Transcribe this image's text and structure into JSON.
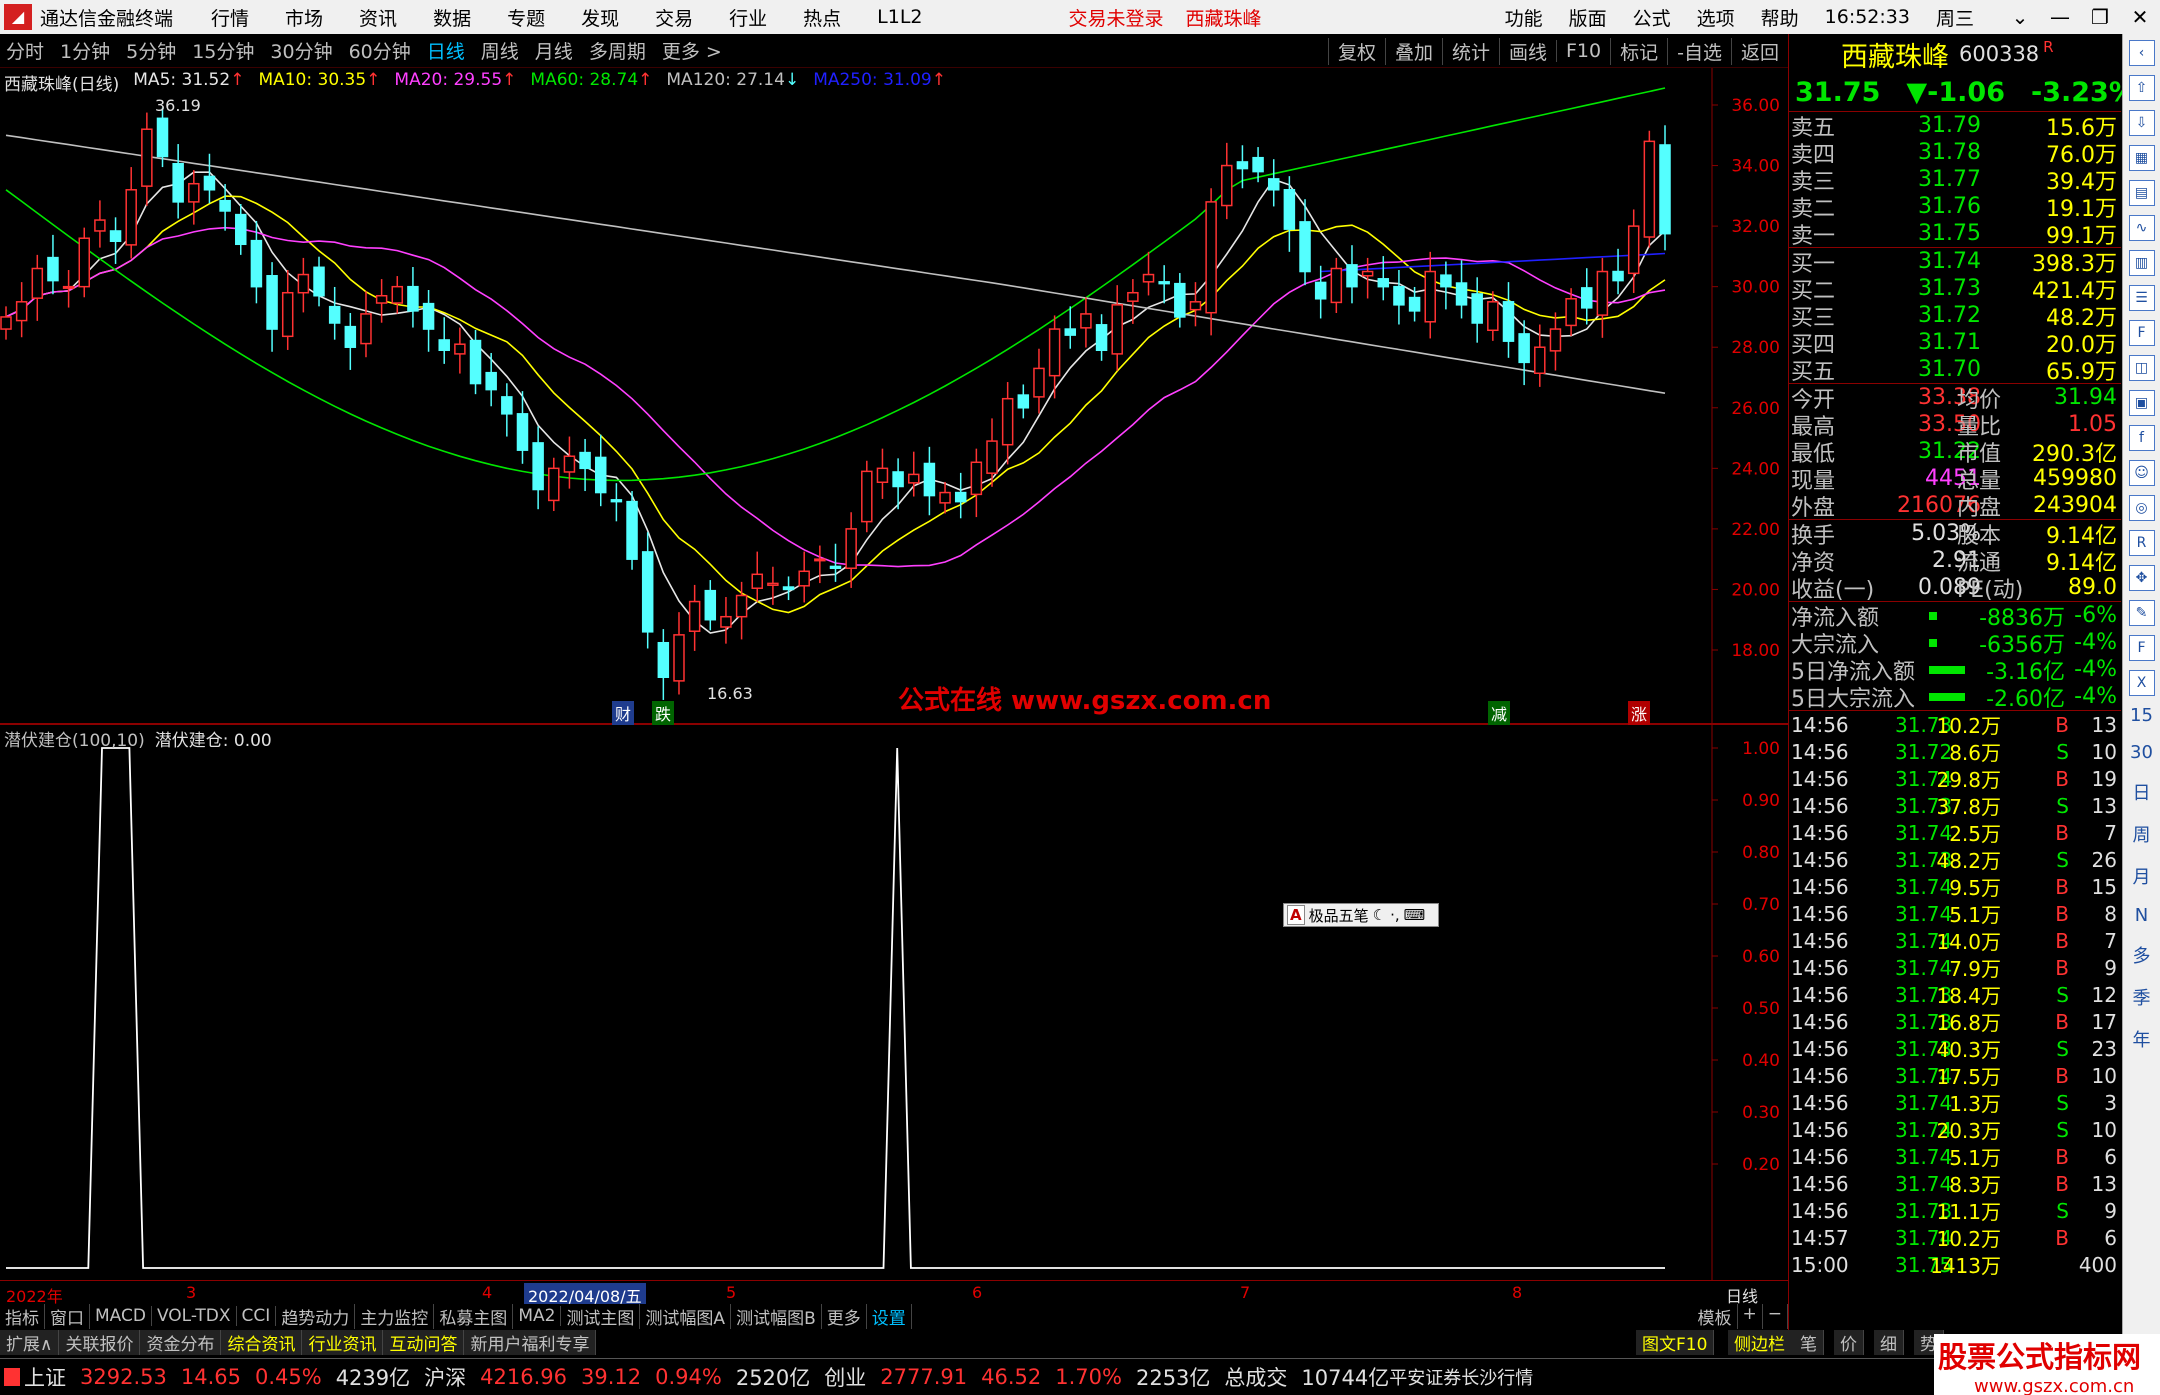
{
  "titlebar": {
    "app_name": "通达信金融终端",
    "menus": [
      "行情",
      "市场",
      "资讯",
      "数据",
      "专题",
      "发现",
      "交易",
      "行业",
      "热点",
      "L1L2"
    ],
    "trade_status": "交易未登录",
    "stock_name": "西藏珠峰",
    "right_menus": [
      "功能",
      "版面",
      "公式",
      "选项",
      "帮助"
    ],
    "time": "16:52:33",
    "weekday": "周三"
  },
  "periodbar": {
    "periods": [
      "分时",
      "1分钟",
      "5分钟",
      "15分钟",
      "30分钟",
      "60分钟",
      "日线",
      "周线",
      "月线",
      "多周期",
      "更多 >"
    ],
    "active": "日线",
    "right_tools": [
      "复权",
      "叠加",
      "统计",
      "画线",
      "F10",
      "标记",
      "-自选",
      "返回"
    ]
  },
  "main_header": {
    "name": "西藏珠峰(日线)",
    "ma5": "MA5: 31.52",
    "ma10": "MA10: 30.35",
    "ma20": "MA20: 29.55",
    "ma60": "MA60: 28.74",
    "ma120": "MA120: 27.14",
    "ma250": "MA250: 31.09",
    "ma5_dir": "↑",
    "ma10_dir": "↑",
    "ma20_dir": "↑",
    "ma60_dir": "↑",
    "ma120_dir": "↓",
    "ma250_dir": "↑"
  },
  "sub_header": {
    "name": "潜伏建仓(100,10)",
    "value": "潜伏建仓: 0.00"
  },
  "labels": {
    "high_mark": "36.19",
    "low_mark": "16.63",
    "watermark": "公式在线  www.gszx.com.cn",
    "bubble_cai": "财",
    "bubble_die": "跌",
    "bubble_jian": "减",
    "bubble_zhang": "涨",
    "ime": "极品五笔",
    "ime_a": "A"
  },
  "colors": {
    "ma5": "#e6e6e6",
    "ma10": "#ffff00",
    "ma20": "#ff40ff",
    "ma60": "#00e600",
    "ma120": "#c0c0c0",
    "ma250": "#2020ff",
    "up": "#ff3232",
    "down": "#54ffff"
  },
  "chart_data": [
    {
      "type": "candlestick",
      "title": "西藏珠峰(日线)",
      "y_ticks": [
        "36.00",
        "34.00",
        "32.00",
        "30.00",
        "28.00",
        "26.00",
        "24.00",
        "22.00",
        "20.00",
        "18.00"
      ],
      "ylim": [
        16.5,
        36.5
      ],
      "high": 36.19,
      "low": 16.63,
      "close": [
        29.0,
        29.5,
        30.6,
        30.2,
        30.0,
        31.6,
        32.2,
        31.5,
        33.2,
        35.2,
        34.3,
        32.8,
        33.4,
        33.2,
        32.5,
        31.4,
        30.0,
        28.6,
        29.8,
        30.4,
        29.7,
        28.8,
        28.0,
        29.1,
        29.7,
        30.0,
        29.2,
        28.6,
        27.9,
        28.1,
        26.8,
        26.6,
        25.8,
        24.6,
        23.3,
        24.0,
        24.4,
        24.0,
        23.2,
        22.9,
        21.0,
        18.6,
        17.1,
        18.5,
        19.6,
        19.0,
        19.1,
        19.8,
        20.5,
        20.2,
        20.0,
        20.6,
        21.0,
        20.7,
        22.0,
        23.9,
        24.0,
        23.4,
        23.8,
        23.1,
        23.2,
        22.9,
        24.2,
        24.9,
        26.3,
        26.0,
        27.3,
        28.6,
        28.4,
        29.1,
        27.9,
        29.4,
        29.8,
        30.4,
        30.1,
        29.0,
        29.5,
        32.8,
        34.0,
        33.9,
        33.8,
        33.2,
        31.9,
        30.5,
        29.6,
        30.6,
        30.0,
        30.5,
        30.0,
        29.4,
        29.2,
        30.5,
        30.0,
        29.4,
        28.8,
        29.5,
        28.2,
        27.5,
        28.0,
        28.6,
        29.6,
        29.3,
        30.5,
        30.2,
        32.0,
        34.8,
        31.75
      ],
      "ma_lines": [
        "MA5",
        "MA10",
        "MA20",
        "MA60",
        "MA120",
        "MA250"
      ]
    },
    {
      "type": "line",
      "title": "潜伏建仓(100,10)",
      "y_ticks": [
        "1.00",
        "0.90",
        "0.80",
        "0.70",
        "0.60",
        "0.50",
        "0.40",
        "0.30",
        "0.20"
      ],
      "ylim": [
        0,
        1
      ],
      "values": [
        0,
        0,
        0,
        0,
        0,
        0,
        0,
        1,
        1,
        1,
        0,
        0,
        0,
        0,
        0,
        0,
        0,
        0,
        0,
        0,
        0,
        0,
        0,
        0,
        0,
        0,
        0,
        0,
        0,
        0,
        0,
        0,
        0,
        0,
        0,
        0,
        0,
        0,
        0,
        0,
        0,
        0,
        0,
        0,
        0,
        0,
        0,
        0,
        0,
        0,
        0,
        0,
        0,
        0,
        0,
        0,
        0,
        0,
        0,
        0,
        0,
        0,
        0,
        0,
        0,
        1,
        0,
        0,
        0,
        0,
        0,
        0,
        0,
        0,
        0,
        0,
        0,
        0,
        0,
        0,
        0,
        0,
        0,
        0,
        0,
        0,
        0,
        0,
        0,
        0,
        0,
        0,
        0,
        0,
        0,
        0,
        0,
        0,
        0,
        0,
        0,
        0,
        0,
        0,
        0,
        0,
        0,
        0,
        0,
        0,
        0,
        0,
        0,
        0,
        0,
        0,
        0,
        0,
        0,
        0,
        0,
        0
      ]
    }
  ],
  "date_axis": {
    "labels": [
      "2022年",
      "3",
      "4",
      "2022/04/08/五",
      "5",
      "6",
      "7",
      "8"
    ],
    "right_label": "日线"
  },
  "indicator_tabs": [
    "指标",
    "窗口",
    "MACD",
    "VOL-TDX",
    "CCI",
    "趋势动力",
    "主力监控",
    "私募主图",
    "MA2",
    "测试主图",
    "测试幅图A",
    "测试幅图B",
    "更多",
    "设置"
  ],
  "indicator_tabs_right": [
    "模板",
    "+",
    "−"
  ],
  "bottom_tabs": [
    "扩展∧",
    "关联报价",
    "资金分布",
    "综合资讯",
    "行业资讯",
    "互动问答",
    "新用户福利专享"
  ],
  "bottom_tabs_right": [
    "图文F10",
    "侧边栏 《",
    "笔",
    "价",
    "细",
    "势"
  ],
  "statusbar": {
    "sh_name": "上证",
    "sh_val": "3292.53",
    "sh_chg": "14.65",
    "sh_pct": "0.45%",
    "sh_amt": "4239亿",
    "hs_name": "沪深",
    "hs_val": "4216.96",
    "hs_chg": "39.12",
    "hs_pct": "0.94%",
    "hs_amt": "2520亿",
    "cy_name": "创业",
    "cy_val": "2777.91",
    "cy_chg": "46.52",
    "cy_pct": "1.70%",
    "cy_amt": "2253亿",
    "total_label": "总成交",
    "total_val": "10744亿",
    "broker": "平安证券长沙行情"
  },
  "quote": {
    "name": "西藏珠峰",
    "code": "600338",
    "flag": "R",
    "price": "31.75",
    "change": "▼-1.06",
    "pct": "-3.23%",
    "asks": [
      {
        "label": "卖五",
        "price": "31.79",
        "vol": "15.6万"
      },
      {
        "label": "卖四",
        "price": "31.78",
        "vol": "76.0万"
      },
      {
        "label": "卖三",
        "price": "31.77",
        "vol": "39.4万"
      },
      {
        "label": "卖二",
        "price": "31.76",
        "vol": "19.1万"
      },
      {
        "label": "卖一",
        "price": "31.75",
        "vol": "99.1万"
      }
    ],
    "bids": [
      {
        "label": "买一",
        "price": "31.74",
        "vol": "398.3万"
      },
      {
        "label": "买二",
        "price": "31.73",
        "vol": "421.4万"
      },
      {
        "label": "买三",
        "price": "31.72",
        "vol": "48.2万"
      },
      {
        "label": "买四",
        "price": "31.71",
        "vol": "20.0万"
      },
      {
        "label": "买五",
        "price": "31.70",
        "vol": "65.9万"
      }
    ],
    "stats1": [
      {
        "l": "今开",
        "m": "33.38",
        "l2": "均价",
        "v": "31.94"
      },
      {
        "l": "最高",
        "m": "33.50",
        "l2": "量比",
        "v": "1.05"
      },
      {
        "l": "最低",
        "m": "31.22",
        "l2": "市值",
        "v": "290.3亿"
      },
      {
        "l": "现量",
        "m": "4451",
        "l2": "总量",
        "v": "459980"
      },
      {
        "l": "外盘",
        "m": "216076",
        "l2": "内盘",
        "v": "243904"
      }
    ],
    "stats2": [
      {
        "l": "换手",
        "m": "5.03%",
        "l2": "股本",
        "v": "9.14亿"
      },
      {
        "l": "净资",
        "m": "2.91",
        "l2": "流通",
        "v": "9.14亿"
      },
      {
        "l": "收益(一)",
        "m": "0.089",
        "l2": "PE(动)",
        "v": "89.0"
      }
    ],
    "flows": [
      {
        "l": "净流入额",
        "v": "-8836万",
        "p": "-6%"
      },
      {
        "l": "大宗流入",
        "v": "-6356万",
        "p": "-4%"
      },
      {
        "l": "5日净流入额",
        "v": "-3.16亿",
        "p": "-4%"
      },
      {
        "l": "5日大宗流入",
        "v": "-2.60亿",
        "p": "-4%"
      }
    ],
    "ticks": [
      {
        "t": "14:56",
        "p": "31.73",
        "q": "10.2万",
        "bs": "B",
        "n": "13"
      },
      {
        "t": "14:56",
        "p": "31.72",
        "q": "8.6万",
        "bs": "S",
        "n": "10"
      },
      {
        "t": "14:56",
        "p": "31.74",
        "q": "29.8万",
        "bs": "B",
        "n": "19"
      },
      {
        "t": "14:56",
        "p": "31.73",
        "q": "37.8万",
        "bs": "S",
        "n": "13"
      },
      {
        "t": "14:56",
        "p": "31.74",
        "q": "2.5万",
        "bs": "B",
        "n": "7"
      },
      {
        "t": "14:56",
        "p": "31.73",
        "q": "48.2万",
        "bs": "S",
        "n": "26"
      },
      {
        "t": "14:56",
        "p": "31.74",
        "q": "9.5万",
        "bs": "B",
        "n": "15"
      },
      {
        "t": "14:56",
        "p": "31.74",
        "q": "5.1万",
        "bs": "B",
        "n": "8"
      },
      {
        "t": "14:56",
        "p": "31.74",
        "q": "14.0万",
        "bs": "B",
        "n": "7"
      },
      {
        "t": "14:56",
        "p": "31.74",
        "q": "7.9万",
        "bs": "B",
        "n": "9"
      },
      {
        "t": "14:56",
        "p": "31.73",
        "q": "18.4万",
        "bs": "S",
        "n": "12"
      },
      {
        "t": "14:56",
        "p": "31.73",
        "q": "16.8万",
        "bs": "B",
        "n": "17"
      },
      {
        "t": "14:56",
        "p": "31.73",
        "q": "40.3万",
        "bs": "S",
        "n": "23"
      },
      {
        "t": "14:56",
        "p": "31.74",
        "q": "17.5万",
        "bs": "B",
        "n": "10"
      },
      {
        "t": "14:56",
        "p": "31.74",
        "q": "1.3万",
        "bs": "S",
        "n": "3"
      },
      {
        "t": "14:56",
        "p": "31.74",
        "q": "20.3万",
        "bs": "S",
        "n": "10"
      },
      {
        "t": "14:56",
        "p": "31.74",
        "q": "5.1万",
        "bs": "B",
        "n": "6"
      },
      {
        "t": "14:56",
        "p": "31.74",
        "q": "8.3万",
        "bs": "B",
        "n": "13"
      },
      {
        "t": "14:56",
        "p": "31.73",
        "q": "11.1万",
        "bs": "S",
        "n": "9"
      },
      {
        "t": "14:57",
        "p": "31.74",
        "q": "10.2万",
        "bs": "B",
        "n": "6"
      },
      {
        "t": "15:00",
        "p": "31.75",
        "q": "1413万",
        "bs": "",
        "n": "400"
      }
    ]
  },
  "sidebar_text": [
    "15",
    "30",
    "日",
    "周",
    "月",
    "N",
    "多",
    "季",
    "年"
  ],
  "logo": {
    "line1": "股票公式指标网",
    "line2": "www.gszx.com.cn"
  }
}
